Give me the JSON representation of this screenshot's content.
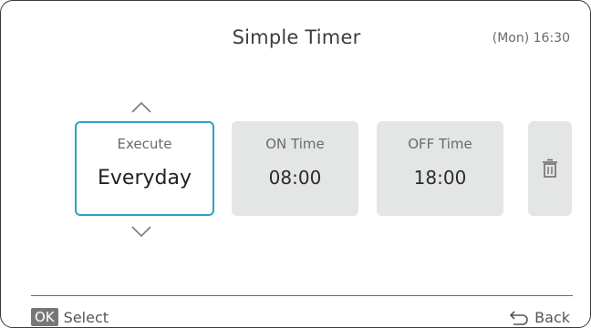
{
  "header": {
    "title": "Simple Timer",
    "clock": "(Mon) 16:30"
  },
  "cards": {
    "execute": {
      "label": "Execute",
      "value": "Everyday"
    },
    "on_time": {
      "label": "ON Time",
      "value": "08:00"
    },
    "off_time": {
      "label": "OFF Time",
      "value": "18:00"
    }
  },
  "footer": {
    "ok_badge": "OK",
    "select_label": "Select",
    "back_label": "Back"
  },
  "colors": {
    "focus_border": "#2aa3c7",
    "card_bg": "#e4e6e6"
  },
  "icons": [
    "chevron-up-icon",
    "chevron-down-icon",
    "trash-icon",
    "back-arrow-icon"
  ]
}
